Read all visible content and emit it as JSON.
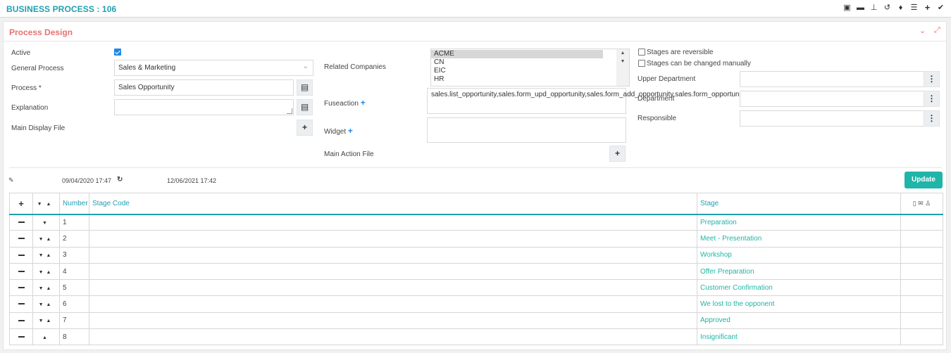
{
  "header": {
    "title": "BUSINESS PROCESS : 106",
    "icons": [
      "qr-icon",
      "folder-icon",
      "hierarchy-icon",
      "history-icon",
      "bell-icon",
      "list-icon",
      "plus-icon",
      "check-icon"
    ]
  },
  "panel": {
    "title": "Process Design"
  },
  "form": {
    "active_label": "Active",
    "general_process_label": "General Process",
    "general_process_value": "Sales & Marketing",
    "process_label": "Process *",
    "process_value": "Sales Opportunity",
    "explanation_label": "Explanation",
    "main_display_file_label": "Main Display File",
    "related_companies_label": "Related Companies",
    "related_companies": [
      "ACME",
      "CN",
      "EIC",
      "HR"
    ],
    "fuseaction_label": "Fuseaction",
    "fuseaction_value": "sales.list_opportunity,sales.form_upd_opportunity,sales.form_add_opportunity,sales.form_opportunity",
    "widget_label": "Widget",
    "main_action_file_label": "Main Action File",
    "stages_reversible_label": "Stages are reversible",
    "stages_manual_label": "Stages can be changed manually",
    "upper_department_label": "Upper Department",
    "department_label": "Department",
    "responsible_label": "Responsible"
  },
  "meta": {
    "created": "09/04/2020 17:47",
    "updated": "12/06/2021 17:42",
    "update_button": "Update"
  },
  "table": {
    "headers": {
      "number": "Number",
      "stage_code": "Stage Code",
      "stage": "Stage"
    },
    "rows": [
      {
        "number": "1",
        "stage": "Preparation"
      },
      {
        "number": "2",
        "stage": "Meet - Presentation"
      },
      {
        "number": "3",
        "stage": "Workshop"
      },
      {
        "number": "4",
        "stage": "Offer Preparation"
      },
      {
        "number": "5",
        "stage": "Customer Confirmation"
      },
      {
        "number": "6",
        "stage": "We lost to the opponent"
      },
      {
        "number": "7",
        "stage": "Approved"
      },
      {
        "number": "8",
        "stage": "Insignificant"
      }
    ]
  }
}
